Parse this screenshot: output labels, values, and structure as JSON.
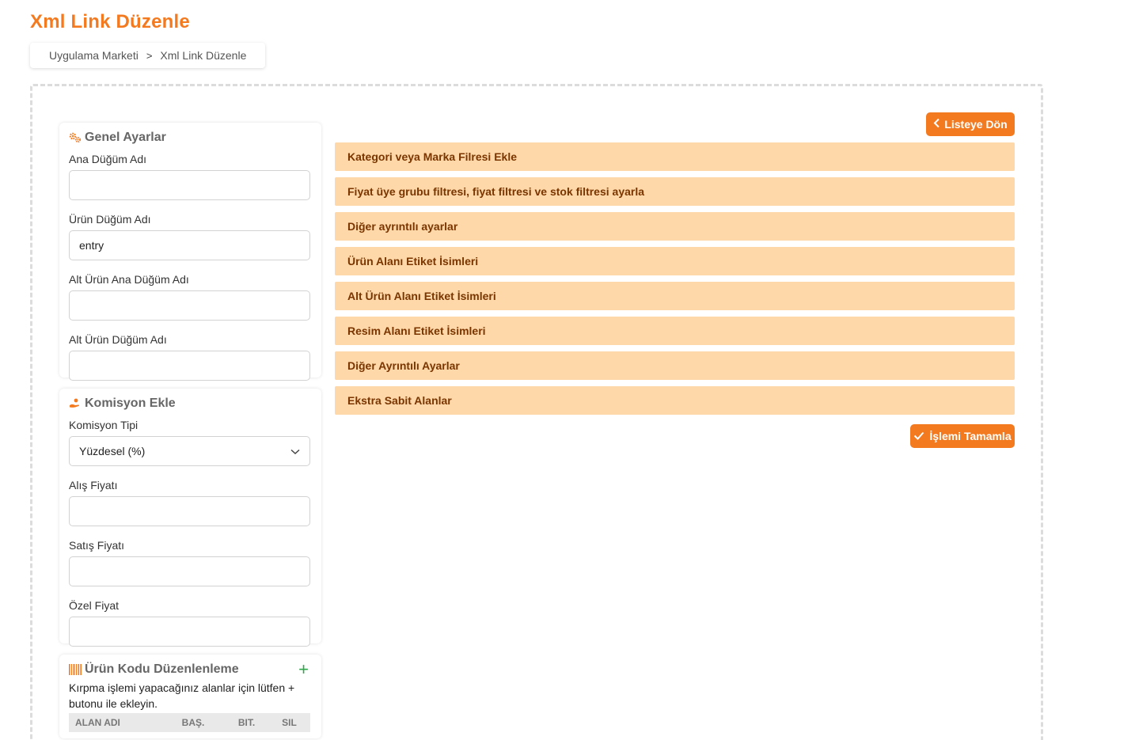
{
  "header": {
    "title": "Xml Link Düzenle"
  },
  "breadcrumb": {
    "items": [
      "Uygulama Marketi",
      "Xml Link Düzenle"
    ],
    "separator": ">"
  },
  "general": {
    "title": "Genel Ayarlar",
    "icon": "gears-icon",
    "fields": [
      {
        "label": "Ana Düğüm Adı",
        "value": ""
      },
      {
        "label": "Ürün Düğüm Adı",
        "value": "entry"
      },
      {
        "label": "Alt Ürün Ana Düğüm Adı",
        "value": ""
      },
      {
        "label": "Alt Ürün Düğüm Adı",
        "value": ""
      }
    ]
  },
  "commission": {
    "title": "Komisyon Ekle",
    "icon": "hand-coin-icon",
    "type_label": "Komisyon Tipi",
    "type_value": "Yüzdesel (%)",
    "fields": [
      {
        "label": "Alış Fiyatı",
        "value": ""
      },
      {
        "label": "Satış Fiyatı",
        "value": ""
      },
      {
        "label": "Özel Fiyat",
        "value": ""
      }
    ]
  },
  "product_code": {
    "title": "Ürün Kodu Düzenlenleme",
    "icon": "barcode-icon",
    "add_label": "+",
    "helper": "Kırpma işlemi yapacağınız alanlar için lütfen + butonu ile ekleyin.",
    "columns": [
      "ALAN ADI",
      "BAŞ.",
      "BIT.",
      "SIL"
    ]
  },
  "actions": {
    "back_label": "Listeye Dön",
    "done_label": "İşlemi Tamamla"
  },
  "accordion": [
    "Kategori veya Marka Filresi Ekle",
    "Fiyat üye grubu filtresi, fiyat filtresi ve stok filtresi ayarla",
    "Diğer ayrıntılı ayarlar",
    "Ürün Alanı Etiket İsimleri",
    "Alt Ürün Alanı Etiket İsimleri",
    "Resim Alanı Etiket İsimleri",
    "Diğer Ayrıntılı Ayarlar",
    "Ekstra Sabit Alanlar"
  ],
  "colors": {
    "accent": "#f47a20",
    "accordion_bg": "#fed8a8",
    "accordion_text": "#7a3500",
    "add_green": "#2ea84a"
  }
}
